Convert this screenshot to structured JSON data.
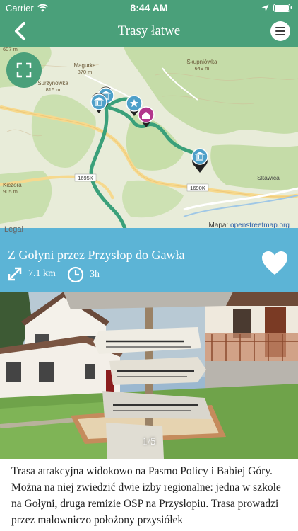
{
  "status_bar": {
    "carrier": "Carrier",
    "time": "8:44 AM"
  },
  "header": {
    "title": "Trasy łatwe"
  },
  "map": {
    "labels": {
      "magurka": "Magurka",
      "magurka_elev": "870 m",
      "surzynowka": "Surzynówka",
      "surzynowka_elev": "816 m",
      "skupniowka": "Skupniówka",
      "skupniowka_elev": "649 m",
      "kiczora": "Kiczora",
      "kiczora_elev": "905 m",
      "road_1695k": "1695K",
      "road_1690k": "1690K",
      "skawica": "Skawica",
      "elev_607": "607 m"
    },
    "attribution_prefix": "Mapa: ",
    "attribution_link": "openstreetmap.org",
    "legal": "Legal",
    "route_color": "#3aa07a"
  },
  "route": {
    "name": "Z Gołyni przez Przysłop do Gawła",
    "distance": "7.1 km",
    "duration": "3h"
  },
  "gallery": {
    "counter": "1/5"
  },
  "description": "Trasa atrakcyjna widokowo na Pasmo Policy i Babiej Góry. Można na niej zwiedzić dwie izby regionalne: jedna w szkole na Gołyni, druga remizie OSP na Przysłopiu. Trasa prowadzi przez malowniczo położony przysiółek",
  "colors": {
    "primary": "#4aa07a",
    "banner": "#5cb4d6"
  }
}
